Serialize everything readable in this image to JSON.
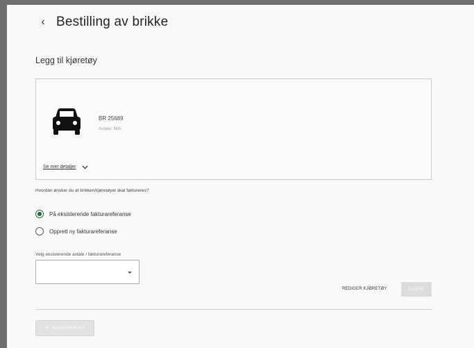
{
  "header": {
    "title": "Bestilling av brikke",
    "back_icon": "chevron-left-icon"
  },
  "section": {
    "title": "Legg til kjøretøy"
  },
  "vehicle": {
    "icon": "car-icon",
    "plate": "BR 25689",
    "agreement": "Avtale: N/A",
    "details_link": "Se mer detaljer",
    "details_icon": "chevron-down-icon"
  },
  "billing": {
    "question": "Hvordan ønsker du at brikken/kjøretøyet skal faktureres?",
    "options": [
      {
        "label": "På eksisterende fakturareferanse",
        "checked": true
      },
      {
        "label": "Opprett ny fakturareferanse",
        "checked": false
      }
    ]
  },
  "agreement_select": {
    "label": "Velg eksisterende avtale / fakturareferanse",
    "value": ""
  },
  "actions": {
    "edit_label": "REDIGER KJØRETØY",
    "save_label": "LAGRE"
  },
  "footer": {
    "register_label": "REGISTRER NY",
    "register_icon": "plus-icon"
  },
  "colors": {
    "accent": "#2a6a3c",
    "disabled": "#dcdcdc"
  }
}
